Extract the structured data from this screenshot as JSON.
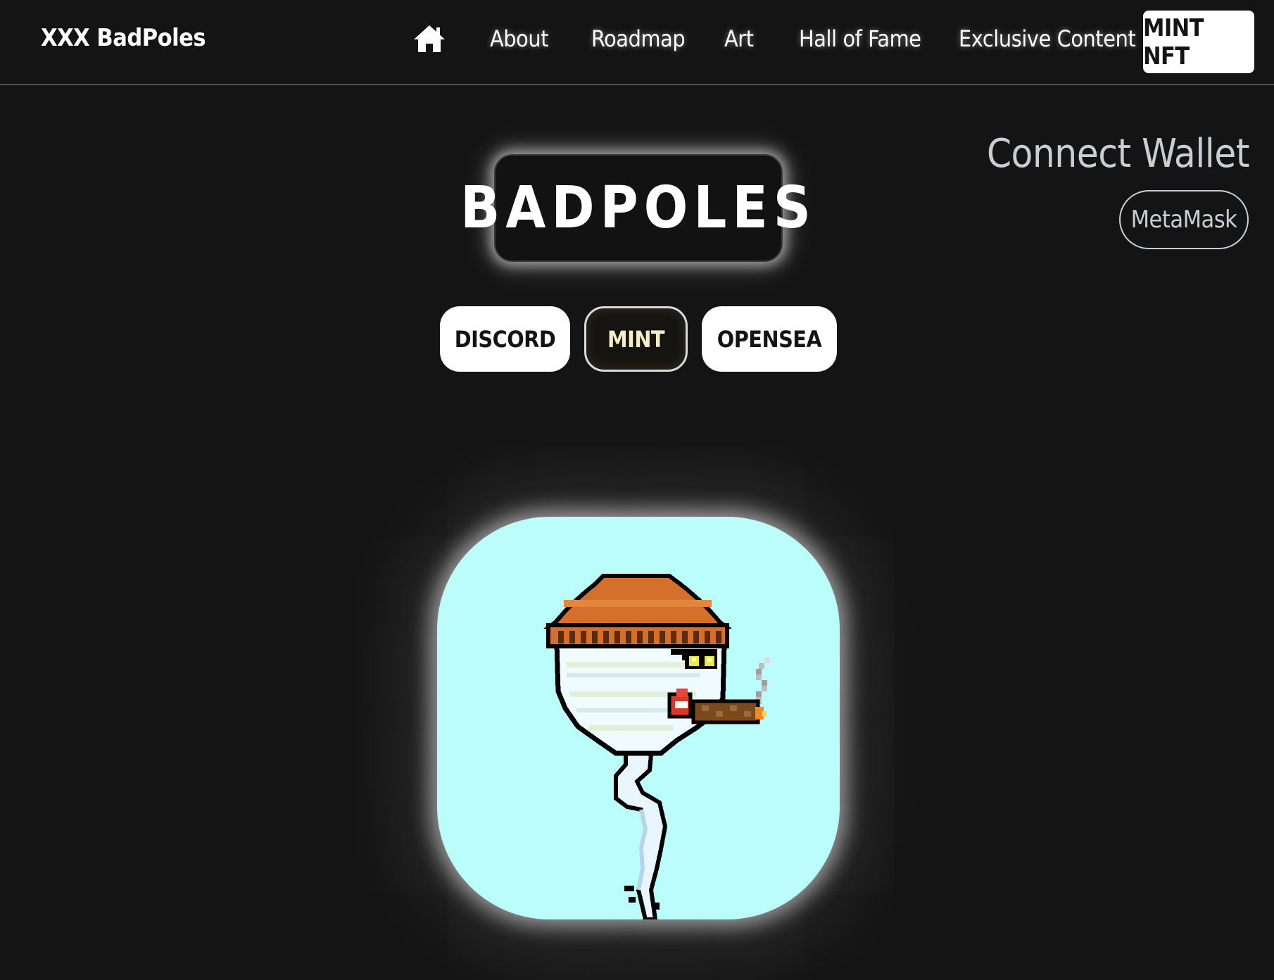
{
  "nav": {
    "brand": "XXX BadPoles",
    "home_icon": "home-icon",
    "links": [
      "About",
      "Roadmap",
      "Art",
      "Hall of Fame",
      "Exclusive Content"
    ],
    "cta": "MINT NFT"
  },
  "wallet": {
    "title": "Connect Wallet",
    "button": "MetaMask"
  },
  "hero": {
    "title": "BADPOLES",
    "buttons": [
      "DISCORD",
      "MINT",
      "OPENSEA"
    ]
  },
  "colors": {
    "background": "#141414",
    "nft_background": "#bbfdfb",
    "hat": "#d4702c",
    "text": "#ffffff",
    "muted": "#c9ced3"
  }
}
